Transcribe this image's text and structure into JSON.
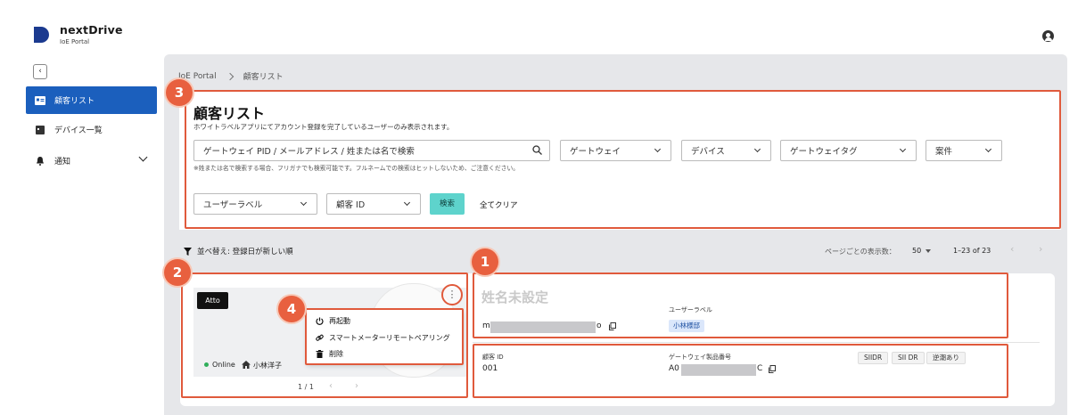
{
  "app": {
    "logo_name": "nextDrive",
    "logo_sub": "IoE Portal"
  },
  "sidebar": {
    "collapse_glyph": "‹",
    "items": [
      {
        "label": "顧客リスト",
        "icon": "customer-list-icon",
        "active": true
      },
      {
        "label": "デバイス一覧",
        "icon": "device-icon",
        "active": false
      },
      {
        "label": "通知",
        "icon": "bell-icon",
        "active": false
      }
    ]
  },
  "breadcrumb": [
    "IoE Portal",
    "顧客リスト"
  ],
  "filters": {
    "title": "顧客リスト",
    "description": "ホワイトラベルアプリにてアカウント登録を完了しているユーザーのみ表示されます。",
    "search_placeholder": "ゲートウェイ PID / メールアドレス / 姓または名で検索",
    "hint": "※姓または名で検索する場合、フリガナでも検索可能です。フルネームでの検索はヒットしないため、ご注意ください。",
    "dropdowns": {
      "gateway": "ゲートウェイ",
      "device": "デバイス",
      "gateway_tag": "ゲートウェイタグ",
      "project": "案件",
      "user_label": "ユーザーラベル",
      "customer_id": "顧客 ID"
    },
    "search_button": "検索",
    "clear_button": "全てクリア"
  },
  "list_toolbar": {
    "sort_label": "並べ替え: 登録日が新しい順",
    "per_page_label": "ページごとの表示数：",
    "per_page_value": "50",
    "range": "1–23 of 23",
    "prev": "‹",
    "next": "›"
  },
  "customer_card": {
    "device_badge": "Atto",
    "kebab_glyph": "⋮",
    "status": "Online",
    "owner": "小林洋子",
    "slider_page": "1 / 1",
    "slider_prev": "‹",
    "slider_next": "›",
    "menu": [
      {
        "label": "再起動",
        "icon": "power-icon"
      },
      {
        "label": "スマートメーターリモートペアリング",
        "icon": "link-icon"
      },
      {
        "label": "削除",
        "icon": "trash-icon"
      }
    ],
    "name": "姓名未設定",
    "email_prefix": "m",
    "email_suffix": "o",
    "user_label_title": "ユーザーラベル",
    "user_label_value": "小林様邸",
    "customer_id_title": "顧客 ID",
    "customer_id_value": "001",
    "gateway_serial_title": "ゲートウェイ製品番号",
    "gateway_serial_prefix": "A0",
    "gateway_serial_suffix": "C",
    "chips": [
      "SIIDR",
      "SII DR",
      "逆潮あり"
    ]
  },
  "annotations": [
    "1",
    "2",
    "3",
    "4"
  ],
  "colors": {
    "primary": "#1b5fbd",
    "search_button": "#5ed3cc",
    "annotation_red": "#e05a3c",
    "online_green": "#2fae5a"
  }
}
